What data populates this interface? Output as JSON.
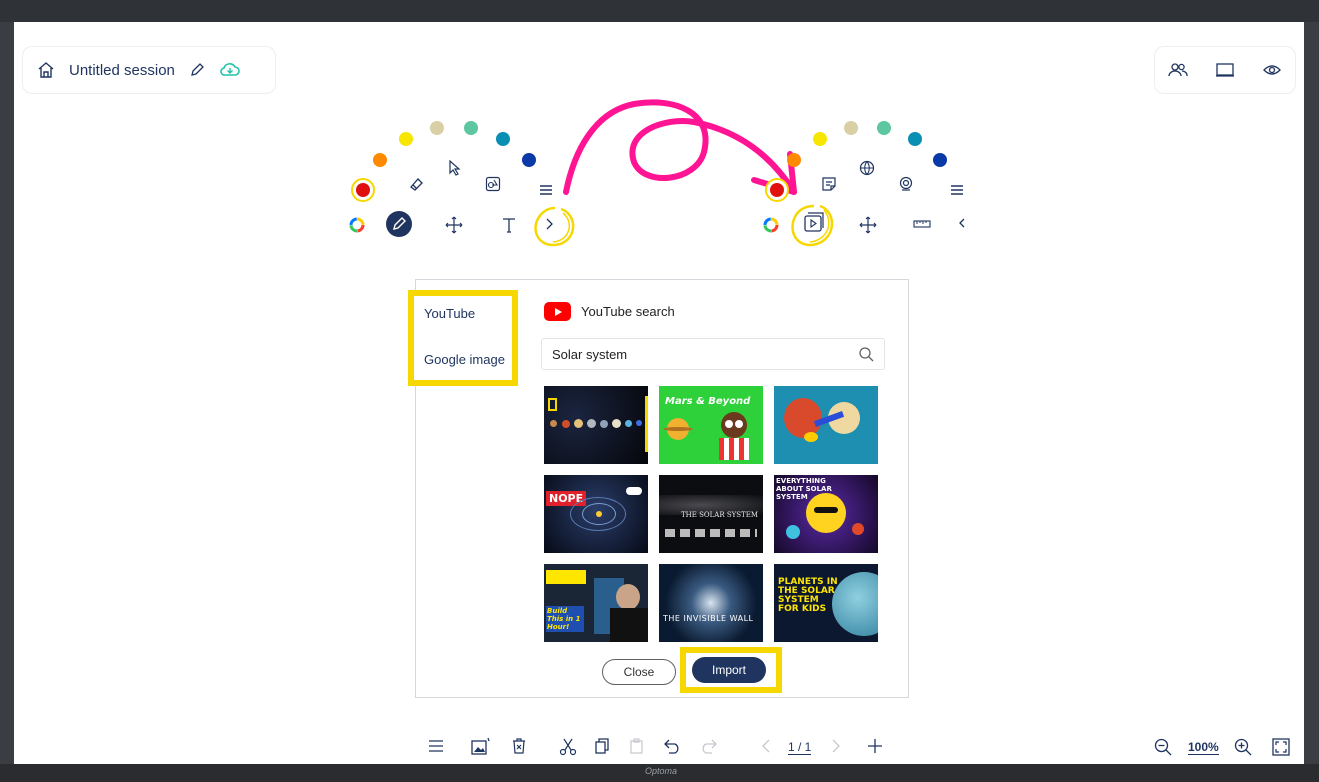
{
  "header": {
    "session_title": "Untitled session",
    "cloud_color": "#22c3a6"
  },
  "palette": {
    "left_colors": [
      "#ff8a00",
      "#f6e600",
      "#d9cfa4",
      "#5cc7a0",
      "#0a8fb4",
      "#0a3aa8"
    ],
    "right_colors": [
      "#ff8a00",
      "#f6e600",
      "#d9cfa4",
      "#5cc7a0",
      "#0a8fb4",
      "#0a3aa8"
    ],
    "selected_color": "#e01010",
    "annotation_color": "#ff1493",
    "highlight_color": "#f6d700"
  },
  "dialog": {
    "sources": [
      {
        "label": "YouTube"
      },
      {
        "label": "Google image"
      }
    ],
    "heading": "YouTube search",
    "search_value": "Solar system",
    "thumbnails": [
      {
        "caption": ""
      },
      {
        "caption": "Mars & Beyond"
      },
      {
        "caption": ""
      },
      {
        "caption": "NOPE"
      },
      {
        "caption": "THE SOLAR SYSTEM"
      },
      {
        "caption": "EVERYTHING ABOUT SOLAR SYSTEM"
      },
      {
        "caption": "Build This in 1 Hour!"
      },
      {
        "caption": "THE INVISIBLE WALL"
      },
      {
        "caption": "PLANETS IN THE SOLAR SYSTEM FOR KIDS"
      }
    ],
    "close_label": "Close",
    "import_label": "Import"
  },
  "footer": {
    "page_indicator": "1 / 1",
    "zoom_level": "100%"
  },
  "brand": "Optoma"
}
